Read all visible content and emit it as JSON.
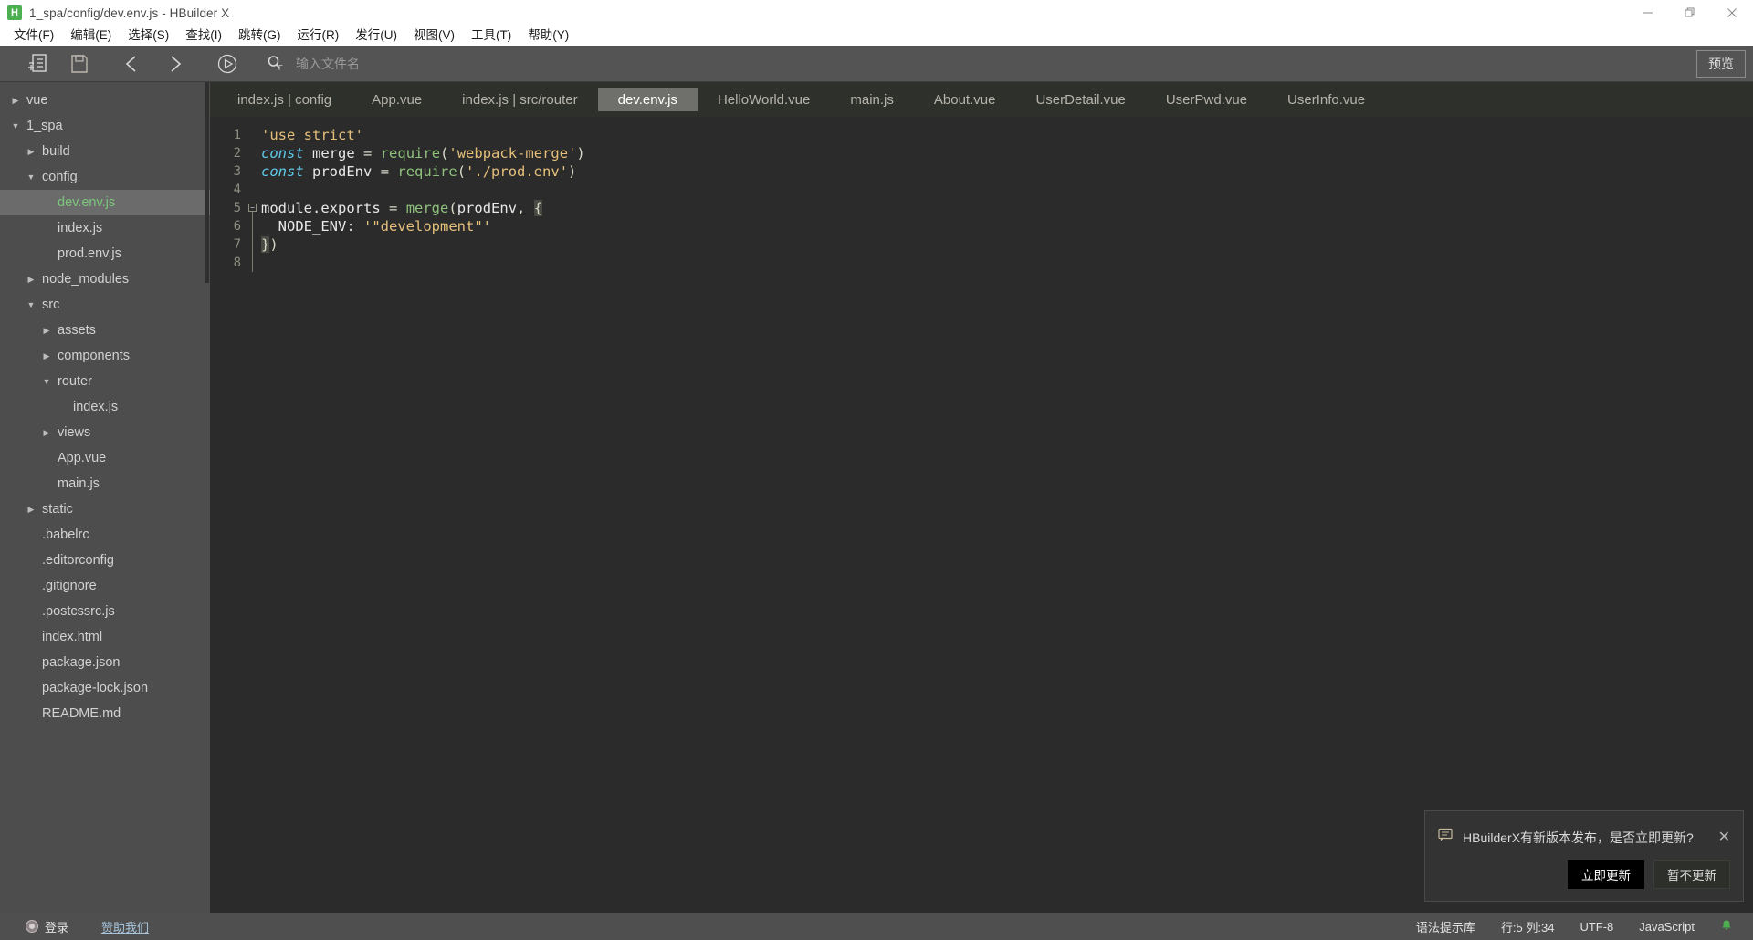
{
  "window": {
    "title": "1_spa/config/dev.env.js - HBuilder X",
    "logo_text": "H",
    "minimize_icon": "minimize-icon",
    "maximize_icon": "restore-icon",
    "close_icon": "close-icon"
  },
  "menubar": {
    "items": [
      {
        "label": "文件(F)",
        "name": "menu-file"
      },
      {
        "label": "编辑(E)",
        "name": "menu-edit"
      },
      {
        "label": "选择(S)",
        "name": "menu-select"
      },
      {
        "label": "查找(I)",
        "name": "menu-find"
      },
      {
        "label": "跳转(G)",
        "name": "menu-goto"
      },
      {
        "label": "运行(R)",
        "name": "menu-run"
      },
      {
        "label": "发行(U)",
        "name": "menu-publish"
      },
      {
        "label": "视图(V)",
        "name": "menu-view"
      },
      {
        "label": "工具(T)",
        "name": "menu-tools"
      },
      {
        "label": "帮助(Y)",
        "name": "menu-help"
      }
    ]
  },
  "toolbar": {
    "new_file_icon": "new-file-icon",
    "save_icon": "save-icon",
    "back_icon": "back-arrow-icon",
    "forward_icon": "forward-arrow-icon",
    "run_icon": "run-play-icon",
    "search_icon": "search-file-icon",
    "search_placeholder": "输入文件名",
    "search_value": "",
    "preview_label": "预览"
  },
  "sidebar": {
    "tree": [
      {
        "label": "vue",
        "indent": 0,
        "arrow": "collapsed",
        "selected": false
      },
      {
        "label": "1_spa",
        "indent": 0,
        "arrow": "expanded",
        "selected": false
      },
      {
        "label": "build",
        "indent": 1,
        "arrow": "collapsed",
        "selected": false
      },
      {
        "label": "config",
        "indent": 1,
        "arrow": "expanded",
        "selected": false
      },
      {
        "label": "dev.env.js",
        "indent": 2,
        "arrow": "none",
        "selected": true
      },
      {
        "label": "index.js",
        "indent": 2,
        "arrow": "none",
        "selected": false
      },
      {
        "label": "prod.env.js",
        "indent": 2,
        "arrow": "none",
        "selected": false
      },
      {
        "label": "node_modules",
        "indent": 1,
        "arrow": "collapsed",
        "selected": false
      },
      {
        "label": "src",
        "indent": 1,
        "arrow": "expanded",
        "selected": false
      },
      {
        "label": "assets",
        "indent": 2,
        "arrow": "collapsed",
        "selected": false
      },
      {
        "label": "components",
        "indent": 2,
        "arrow": "collapsed",
        "selected": false
      },
      {
        "label": "router",
        "indent": 2,
        "arrow": "expanded",
        "selected": false
      },
      {
        "label": "index.js",
        "indent": 3,
        "arrow": "none",
        "selected": false
      },
      {
        "label": "views",
        "indent": 2,
        "arrow": "collapsed",
        "selected": false
      },
      {
        "label": "App.vue",
        "indent": 2,
        "arrow": "none",
        "selected": false
      },
      {
        "label": "main.js",
        "indent": 2,
        "arrow": "none",
        "selected": false
      },
      {
        "label": "static",
        "indent": 1,
        "arrow": "collapsed",
        "selected": false
      },
      {
        "label": ".babelrc",
        "indent": 1,
        "arrow": "none",
        "selected": false
      },
      {
        "label": ".editorconfig",
        "indent": 1,
        "arrow": "none",
        "selected": false
      },
      {
        "label": ".gitignore",
        "indent": 1,
        "arrow": "none",
        "selected": false
      },
      {
        "label": ".postcssrc.js",
        "indent": 1,
        "arrow": "none",
        "selected": false
      },
      {
        "label": "index.html",
        "indent": 1,
        "arrow": "none",
        "selected": false
      },
      {
        "label": "package.json",
        "indent": 1,
        "arrow": "none",
        "selected": false
      },
      {
        "label": "package-lock.json",
        "indent": 1,
        "arrow": "none",
        "selected": false
      },
      {
        "label": "README.md",
        "indent": 1,
        "arrow": "none",
        "selected": false
      }
    ]
  },
  "tabs": [
    {
      "label": "index.js | config",
      "active": false
    },
    {
      "label": "App.vue",
      "active": false
    },
    {
      "label": "index.js | src/router",
      "active": false
    },
    {
      "label": "dev.env.js",
      "active": true
    },
    {
      "label": "HelloWorld.vue",
      "active": false
    },
    {
      "label": "main.js",
      "active": false
    },
    {
      "label": "About.vue",
      "active": false
    },
    {
      "label": "UserDetail.vue",
      "active": false
    },
    {
      "label": "UserPwd.vue",
      "active": false
    },
    {
      "label": "UserInfo.vue",
      "active": false
    }
  ],
  "editor": {
    "line_numbers": [
      "1",
      "2",
      "3",
      "4",
      "5",
      "6",
      "7",
      "8"
    ],
    "lines": [
      "'use strict'",
      "const merge = require('webpack-merge')",
      "const prodEnv = require('./prod.env')",
      "",
      "module.exports = merge(prodEnv, {",
      "  NODE_ENV: '\"development\"'",
      "})",
      ""
    ],
    "fold_marker": "−"
  },
  "notification": {
    "icon": "message-bubble-icon",
    "message": "HBuilderX有新版本发布，是否立即更新?",
    "close_icon": "close-icon",
    "primary_label": "立即更新",
    "secondary_label": "暂不更新"
  },
  "statusbar": {
    "avatar_icon": "user-avatar-icon",
    "login_label": "登录",
    "sponsor_label": "赞助我们",
    "syntax_label": "语法提示库",
    "cursor_label": "行:5 列:34",
    "encoding_label": "UTF-8",
    "language_label": "JavaScript",
    "bell_icon": "bell-icon"
  },
  "colors": {
    "window_chrome": "#ffffff",
    "toolbar": "#545454",
    "sidebar": "#4d4d4d",
    "editor_bg": "#2b2b2b",
    "tabbar_bg": "#2e312b",
    "accent_green": "#7bc77b",
    "link_blue": "#a8c6dd"
  }
}
